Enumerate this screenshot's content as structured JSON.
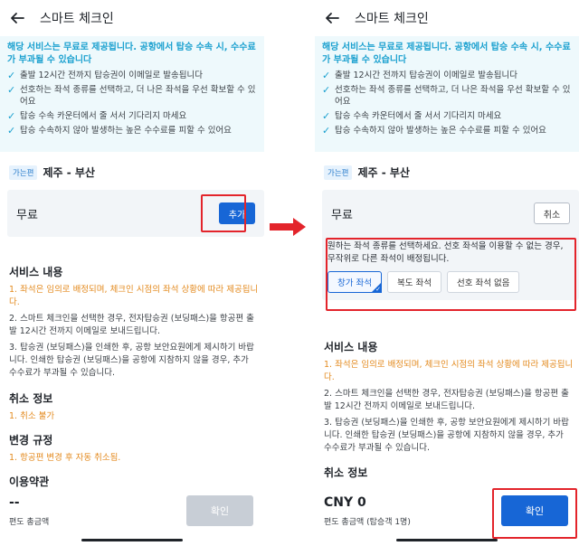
{
  "header": {
    "title": "스마트 체크인"
  },
  "notice": {
    "title": "해당 서비스는 무료로 제공됩니다. 공항에서 탑승 수속 시, 수수료가 부과될 수 있습니다",
    "items": [
      "출발 12시간 전까지 탑승권이 이메일로 발송됩니다",
      "선호하는 좌석 종류를 선택하고, 더 나은 좌석을 우선 확보할 수 있어요",
      "탑승 수속 카운터에서 줄 서서 기다리지 마세요",
      "탑승 수속하지 않아 발생하는 높은 수수료를 피할 수 있어요"
    ]
  },
  "route": {
    "badge": "가는편",
    "text": "제주 - 부산"
  },
  "free": {
    "label": "무료",
    "add_label": "추가",
    "cancel_label": "취소"
  },
  "seat": {
    "info": "원하는 좌석 종류를 선택하세요. 선호 좌석을 이용할 수 없는 경우, 무작위로 다른 좌석이 배정됩니다.",
    "options": [
      "창가 좌석",
      "복도 좌석",
      "선호 좌석 없음"
    ],
    "selected_index": 0
  },
  "service": {
    "title": "서비스 내용",
    "items": [
      "1. 좌석은 임의로 배정되며, 체크인 시점의 좌석 상황에 따라 제공됩니다.",
      "2. 스마트 체크인을 선택한 경우, 전자탑승권 (보딩패스)을 항공편 출발 12시간 전까지 이메일로 보내드립니다.",
      "3. 탑승권 (보딩패스)을 인쇄한 후, 공항 보안요원에게 제시하기 바랍니다. 인쇄한 탑승권 (보딩패스)을 공항에 지참하지 않을 경우, 추가 수수료가 부과될 수 있습니다."
    ]
  },
  "cancel_info": {
    "title": "취소 정보",
    "text": "1. 취소 불가"
  },
  "change_rule": {
    "title": "변경 규정",
    "text": "1. 항공편 변경 후 자동 취소됨."
  },
  "terms": {
    "title": "이용약관"
  },
  "bottom_left": {
    "total": "--",
    "caption": "편도 총금액",
    "confirm": "확인"
  },
  "bottom_right": {
    "total": "CNY 0",
    "caption": "편도 총금액 (탑승객 1명)",
    "confirm": "확인"
  },
  "colors": {
    "primary": "#1766d6",
    "notice_bg": "#eef9fc",
    "notice_accent": "#1aa0cf",
    "orange": "#e38a1e",
    "highlight": "#e3242b",
    "disabled": "#c8ced6"
  }
}
